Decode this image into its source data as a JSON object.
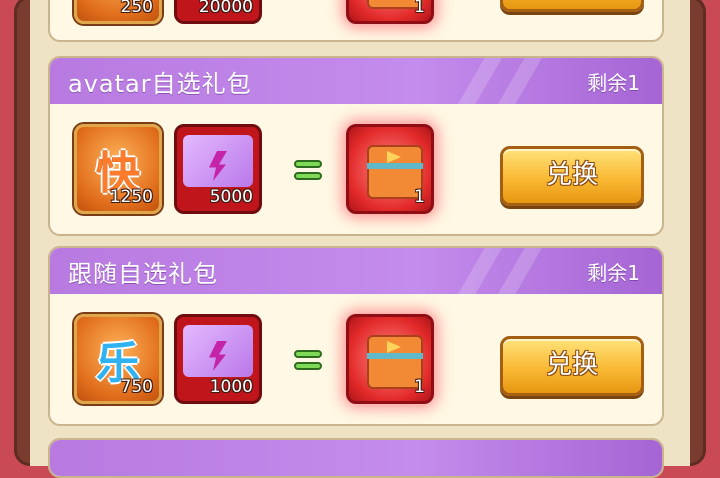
{
  "colors": {
    "header": "#b87ae0",
    "button": "#f9b934",
    "card_bg": "#fff8e4",
    "frame": "#7a3c2f"
  },
  "top_partial_pack": {
    "item1_qty": "250",
    "item2_qty": "20000",
    "reward_qty": "1"
  },
  "packs": [
    {
      "title": "avatar自选礼包",
      "remaining": "剩余1",
      "item1_glyph": "快",
      "item1_qty": "1250",
      "item1_icon": "speed-icon",
      "item2_qty": "5000",
      "item2_icon": "lightning-card-icon",
      "reward_qty": "1",
      "reward_icon": "treasure-chest-icon",
      "button_label": "兑换"
    },
    {
      "title": "跟随自选礼包",
      "remaining": "剩余1",
      "item1_glyph": "乐",
      "item1_qty": "750",
      "item1_icon": "music-note-icon",
      "item2_qty": "1000",
      "item2_icon": "lightning-card-icon",
      "reward_qty": "1",
      "reward_icon": "treasure-chest-icon",
      "button_label": "兑换"
    }
  ]
}
